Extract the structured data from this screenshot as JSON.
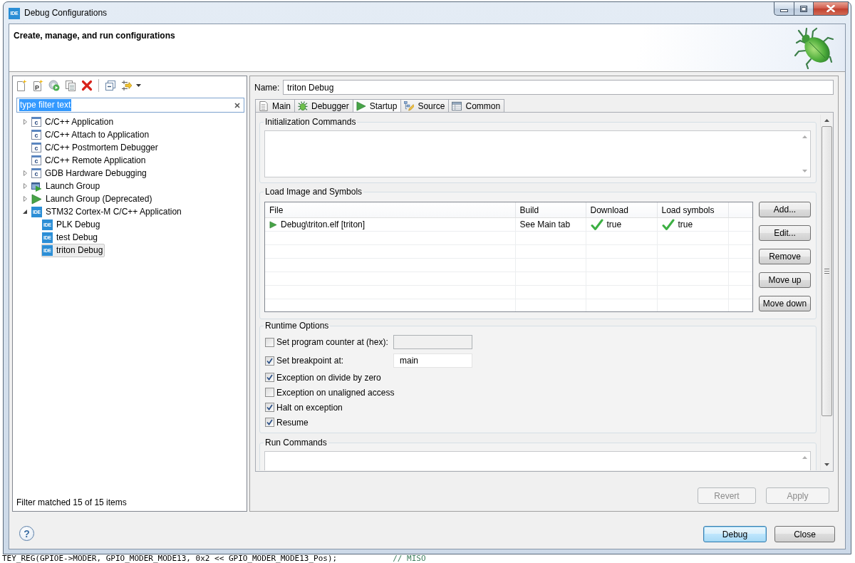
{
  "window": {
    "icon_text": "IDE",
    "title": "Debug Configurations",
    "controls": [
      {
        "kind": "minimize"
      },
      {
        "kind": "maximize"
      },
      {
        "kind": "close"
      }
    ]
  },
  "header": {
    "title": "Create, manage, and run configurations"
  },
  "launch_panel": {
    "toolbar": [
      {
        "kind": "new"
      },
      {
        "kind": "prototype",
        "icon_text": "P"
      },
      {
        "kind": "export"
      },
      {
        "kind": "duplicate"
      },
      {
        "kind": "delete"
      },
      {
        "kind": "separator"
      },
      {
        "kind": "collapse"
      },
      {
        "kind": "filter"
      },
      {
        "kind": "menu"
      }
    ],
    "filter": {
      "value": "type filter text",
      "text_selected": true
    },
    "tree": [
      {
        "label": "C/C++ Application",
        "kind": "c",
        "icon_text": "c",
        "expanded": false,
        "selected": false
      },
      {
        "label": "C/C++ Attach to Application",
        "kind": "c",
        "icon_text": "c",
        "selected": false
      },
      {
        "label": "C/C++ Postmortem Debugger",
        "kind": "c",
        "icon_text": "c",
        "selected": false
      },
      {
        "label": "C/C++ Remote Application",
        "kind": "c",
        "icon_text": "c",
        "selected": false
      },
      {
        "label": "GDB Hardware Debugging",
        "kind": "c",
        "icon_text": "c",
        "expanded": false,
        "selected": false
      },
      {
        "label": "Launch Group",
        "kind": "launch",
        "expanded": false,
        "selected": false
      },
      {
        "label": "Launch Group (Deprecated)",
        "kind": "play",
        "expanded": false,
        "selected": false
      },
      {
        "label": "STM32 Cortex-M C/C++ Application",
        "kind": "ide",
        "icon_text": "IDE",
        "expanded": true,
        "selected": false,
        "children": [
          {
            "label": "PLK Debug",
            "kind": "ide",
            "icon_text": "IDE",
            "selected": false
          },
          {
            "label": "test Debug",
            "kind": "ide",
            "icon_text": "IDE",
            "selected": false
          },
          {
            "label": "triton Debug",
            "kind": "ide",
            "icon_text": "IDE",
            "selected": true
          }
        ]
      }
    ],
    "status": "Filter matched 15 of 15 items"
  },
  "config": {
    "name_label": "Name:",
    "name_value": "triton Debug",
    "tabs": [
      {
        "label": "Main",
        "kind": "page",
        "selected": false
      },
      {
        "label": "Debugger",
        "kind": "bug",
        "selected": false
      },
      {
        "label": "Startup",
        "kind": "play",
        "selected": true
      },
      {
        "label": "Source",
        "kind": "source",
        "selected": false
      },
      {
        "label": "Common",
        "kind": "table",
        "selected": false
      }
    ],
    "init_commands": {
      "title": "Initialization Commands"
    },
    "load_image": {
      "title": "Load Image and Symbols",
      "columns": [
        "File",
        "Build",
        "Download",
        "Load symbols"
      ],
      "rows": [
        {
          "file": "Debug\\triton.elf [triton]",
          "build": "See Main tab",
          "download": {
            "value": "true",
            "checked": true
          },
          "load_symbols": {
            "value": "true",
            "checked": true
          }
        }
      ],
      "buttons": [
        "Add...",
        "Edit...",
        "Remove",
        "Move up",
        "Move down"
      ]
    },
    "runtime_options": {
      "title": "Runtime Options",
      "options": [
        {
          "kind": "field",
          "label": "Set program counter at (hex):",
          "checked": false,
          "field": {
            "disabled": true
          }
        },
        {
          "kind": "field",
          "label": "Set breakpoint at:",
          "checked": true,
          "field": {
            "value": "main",
            "disabled": false
          }
        },
        {
          "kind": "check",
          "label": "Exception on divide by zero",
          "checked": true
        },
        {
          "kind": "check",
          "label": "Exception on unaligned access",
          "checked": false
        },
        {
          "kind": "check",
          "label": "Halt on exception",
          "checked": true
        },
        {
          "kind": "check",
          "label": "Resume",
          "checked": true
        }
      ]
    },
    "run_commands": {
      "title": "Run Commands"
    },
    "buttons": [
      {
        "label": "Revert",
        "disabled": true
      },
      {
        "label": "Apply",
        "disabled": true
      }
    ]
  },
  "dialog_buttons": {
    "help": "?",
    "buttons": [
      {
        "label": "Debug",
        "default": true
      },
      {
        "label": "Close",
        "default": false
      }
    ]
  },
  "background_editor": {
    "code": "TEY_REG(GPIOE->MODER, GPIO_MODER_MODE13, 0x2 << GPIO_MODER_MODE13_Pos);",
    "comment": "// MISO"
  }
}
